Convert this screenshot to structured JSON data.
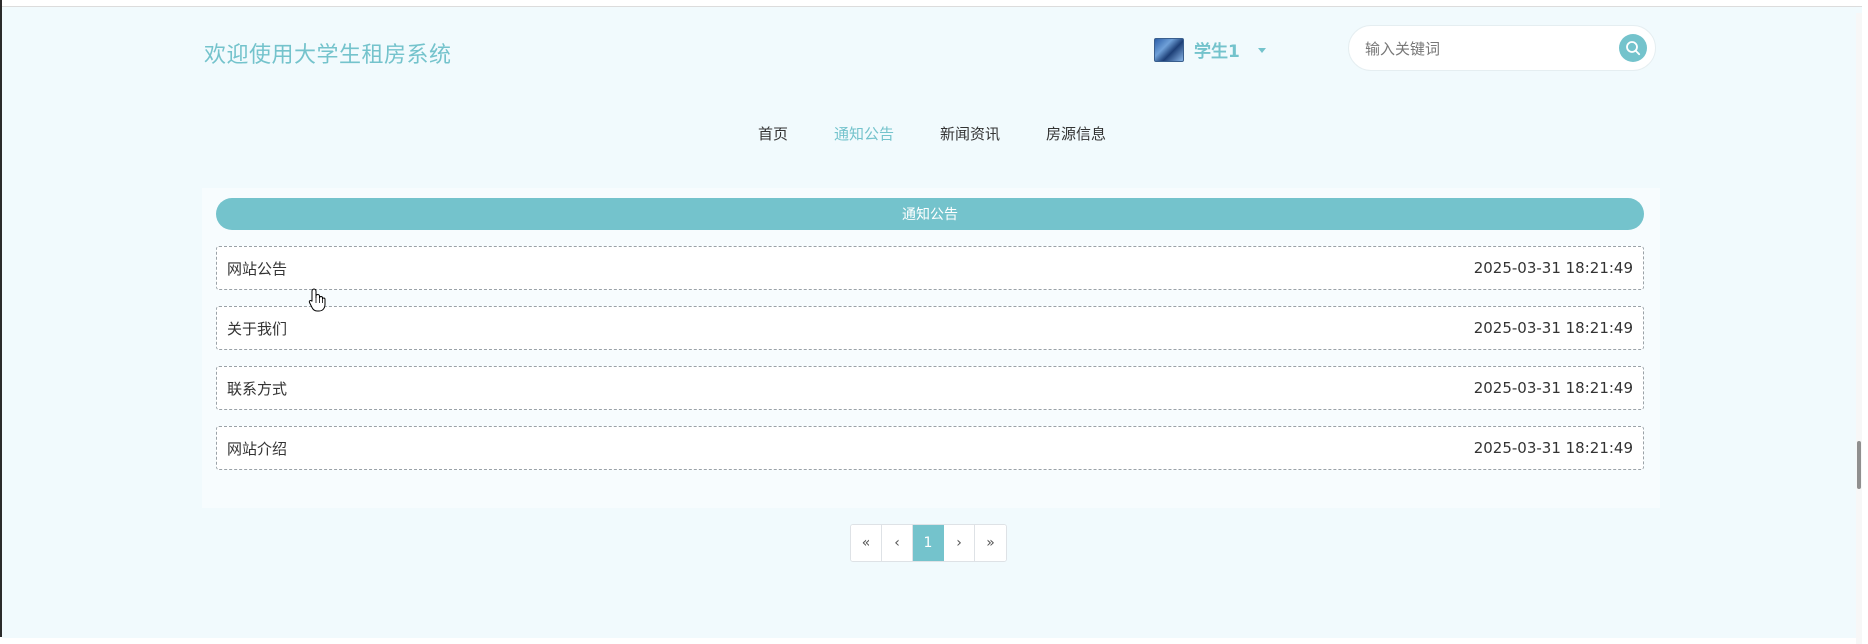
{
  "header": {
    "site_title": "欢迎使用大学生租房系统",
    "user_name": "学生1",
    "search_placeholder": "输入关键词"
  },
  "nav": {
    "items": [
      {
        "label": "首页",
        "active": false
      },
      {
        "label": "通知公告",
        "active": true
      },
      {
        "label": "新闻资讯",
        "active": false
      },
      {
        "label": "房源信息",
        "active": false
      }
    ]
  },
  "panel": {
    "title": "通知公告",
    "items": [
      {
        "title": "网站公告",
        "time": "2025-03-31 18:21:49"
      },
      {
        "title": "关于我们",
        "time": "2025-03-31 18:21:49"
      },
      {
        "title": "联系方式",
        "time": "2025-03-31 18:21:49"
      },
      {
        "title": "网站介绍",
        "time": "2025-03-31 18:21:49"
      }
    ]
  },
  "pagination": {
    "first": "«",
    "prev": "‹",
    "current": "1",
    "next": "›",
    "last": "»"
  },
  "colors": {
    "accent": "#74c3cc",
    "background": "#f1fafd"
  }
}
